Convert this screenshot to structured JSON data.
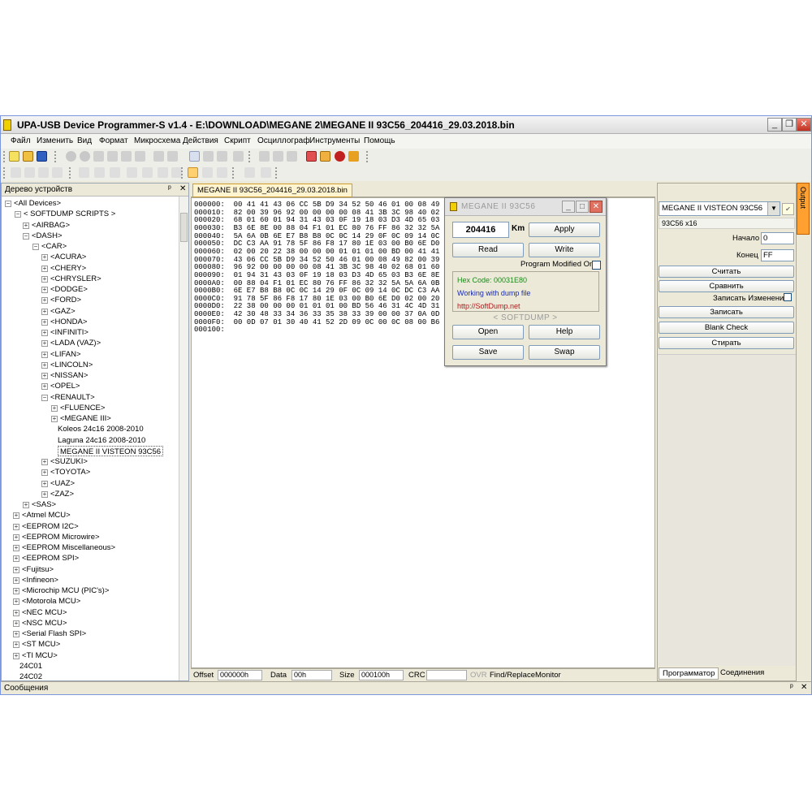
{
  "window": {
    "title": "UPA-USB Device Programmer-S v1.4 - E:\\DOWNLOAD\\MEGANE 2\\MEGANE II 93C56_204416_29.03.2018.bin",
    "minimize": "_",
    "restore": "❐",
    "close": "✕"
  },
  "menu": [
    "Файл",
    "Изменить",
    "Вид",
    "Формат",
    "Микросхема",
    "Действия",
    "Скрипт",
    "Осциллограф",
    "Инструменты",
    "Помощь"
  ],
  "tree_panel": {
    "title": "Дерево устройств",
    "pin": "ᵖ",
    "close": "✕",
    "items": [
      {
        "label": "<All Devices>",
        "exp": "−"
      },
      {
        "label": "< SOFTDUMP SCRIPTS >",
        "exp": "−"
      },
      {
        "label": "<AIRBAG>",
        "exp": "+"
      },
      {
        "label": "<DASH>",
        "exp": "−"
      },
      {
        "label": "<CAR>",
        "exp": "−"
      },
      {
        "label": "<ACURA>",
        "exp": "+"
      },
      {
        "label": "<CHERY>",
        "exp": "+"
      },
      {
        "label": "<CHRYSLER>",
        "exp": "+"
      },
      {
        "label": "<DODGE>",
        "exp": "+"
      },
      {
        "label": "<FORD>",
        "exp": "+"
      },
      {
        "label": "<GAZ>",
        "exp": "+"
      },
      {
        "label": "<HONDA>",
        "exp": "+"
      },
      {
        "label": "<INFINITI>",
        "exp": "+"
      },
      {
        "label": "<LADA (VAZ)>",
        "exp": "+"
      },
      {
        "label": "<LIFAN>",
        "exp": "+"
      },
      {
        "label": "<LINCOLN>",
        "exp": "+"
      },
      {
        "label": "<NISSAN>",
        "exp": "+"
      },
      {
        "label": "<OPEL>",
        "exp": "+"
      },
      {
        "label": "<RENAULT>",
        "exp": "−"
      },
      {
        "label": "<FLUENCE>",
        "exp": "+"
      },
      {
        "label": "<MEGANE III>",
        "exp": "+"
      },
      {
        "label": "Koleos 24c16 2008-2010",
        "exp": ""
      },
      {
        "label": "Laguna 24c16 2008-2010",
        "exp": ""
      },
      {
        "label": "MEGANE II VISTEON 93C56",
        "exp": ""
      },
      {
        "label": "<SUZUKI>",
        "exp": "+"
      },
      {
        "label": "<TOYOTA>",
        "exp": "+"
      },
      {
        "label": "<UAZ>",
        "exp": "+"
      },
      {
        "label": "<ZAZ>",
        "exp": "+"
      },
      {
        "label": "<SAS>",
        "exp": "+"
      },
      {
        "label": "<Atmel MCU>",
        "exp": "+"
      },
      {
        "label": "<EEPROM I2C>",
        "exp": "+"
      },
      {
        "label": "<EEPROM Microwire>",
        "exp": "+"
      },
      {
        "label": "<EEPROM Miscellaneous>",
        "exp": "+"
      },
      {
        "label": "<EEPROM SPI>",
        "exp": "+"
      },
      {
        "label": "<Fujitsu>",
        "exp": "+"
      },
      {
        "label": "<Infineon>",
        "exp": "+"
      },
      {
        "label": "<Microchip MCU (PIC's)>",
        "exp": "+"
      },
      {
        "label": "<Motorola MCU>",
        "exp": "+"
      },
      {
        "label": "<NEC MCU>",
        "exp": "+"
      },
      {
        "label": "<NSC MCU>",
        "exp": "+"
      },
      {
        "label": "<Serial Flash SPI>",
        "exp": "+"
      },
      {
        "label": "<ST MCU>",
        "exp": "+"
      },
      {
        "label": "<TI MCU>",
        "exp": "+"
      },
      {
        "label": "24C01",
        "exp": ""
      },
      {
        "label": "24C02",
        "exp": ""
      }
    ]
  },
  "doc_tab": "MEGANE II 93C56_204416_29.03.2018.bin",
  "hex_lines": [
    "000000:  00 41 41 43 06 CC 5B D9 34 52 50 46 01 00 08 49  . A A C .",
    "000010:  82 00 39 96 92 00 00 00 00 08 41 3B 3C 98 40 02  ▌ . 9 ▌ ▌",
    "000020:  68 01 60 01 94 31 43 03 0F 19 18 03 D3 4D 65 03  h . ` . ▌",
    "000030:  B3 6E 8E 00 88 04 F1 01 EC 80 76 FF 86 32 32 5A  ▌ n ▌ . ▌",
    "000040:  5A 6A 0B 6E E7 B8 B8 0C 0C 14 29 0F 0C 09 14 0C  Z j . n ▌",
    "000050:  DC C3 AA 91 78 5F 86 F8 17 80 1E 03 00 B0 6E D0  ▌ ▌ ▌ ▌ x",
    "000060:  02 00 20 22 38 00 00 00 01 01 01 00 BD 00 41 41  . .   \" 8",
    "000070:  43 06 CC 5B D9 34 52 50 46 01 00 08 49 82 00 39  C . ▌ [ ▌",
    "000080:  96 92 00 00 00 00 08 41 3B 3C 98 40 02 68 01 60  ▌ ▌ . . .",
    "000090:  01 94 31 43 03 0F 19 18 03 D3 4D 65 03 B3 6E 8E  . ▌ 1 C .",
    "0000A0:  00 88 04 F1 01 EC 80 76 FF 86 32 32 5A 5A 6A 0B  . ▌ . ▌ .",
    "0000B0:  6E E7 B8 B8 0C 0C 14 29 0F 0C 09 14 0C DC C3 AA  n ▌ ▌ ▌ .",
    "0000C0:  91 78 5F 86 F8 17 80 1E 03 00 B0 6E D0 02 00 20  ▌ x _ ▌ ▌",
    "0000D0:  22 38 00 00 00 01 01 01 00 BD 56 46 31 4C 4D 31  \" 8 . . .",
    "0000E0:  42 30 48 33 34 36 33 35 38 33 39 00 00 37 0A 0D  B 0 H 3 4",
    "0000F0:  00 0D 07 01 30 40 41 52 2D 09 0C 00 0C 08 00 B6  . . . . 0",
    "000100:"
  ],
  "hex_status": {
    "offset_label": "Offset",
    "offset_value": "000000h",
    "data_label": "Data",
    "data_value": "00h",
    "size_label": "Size",
    "size_value": "000100h",
    "crc_label": "CRC",
    "ovr": "OVR",
    "find_replace": "Find/Replace",
    "monitor": "Monitor"
  },
  "dialog": {
    "title": "MEGANE II 93C56",
    "km_value": "204416",
    "km_label": "Km",
    "apply": "Apply",
    "read": "Read",
    "write": "Write",
    "program_modified": "Program Modified Only",
    "hex_code": "Hex Code: 00031E80",
    "working": "Working with dump file",
    "url": "http://SoftDump.net",
    "brand": "< SOFTDUMP >",
    "open": "Open",
    "help": "Help",
    "save": "Save",
    "swap": "Swap"
  },
  "right_panel": {
    "device": "MEGANE II VISTEON 93C56",
    "device_info": "93C56 x16",
    "start_label": "Начало",
    "start_value": "0",
    "end_label": "Конец",
    "end_value": "FF",
    "read_btn": "Считать",
    "compare_btn": "Сравнить",
    "write_changes": "Записать Изменение",
    "write_btn": "Записать",
    "blank_check": "Blank Check",
    "erase_btn": "Стирать",
    "tab_programmer": "Программатор",
    "tab_connections": "Соединения"
  },
  "output_tab": "Output",
  "messages": {
    "title": "Сообщения"
  },
  "colors": {
    "window_bg": "#ece9d8",
    "selected_tab": "#fff4d0",
    "output_tab": "#ffa030",
    "hex_code_color": "#1a8a1a",
    "working_color": "#1a2ab0",
    "url_color": "#b01a1a"
  }
}
